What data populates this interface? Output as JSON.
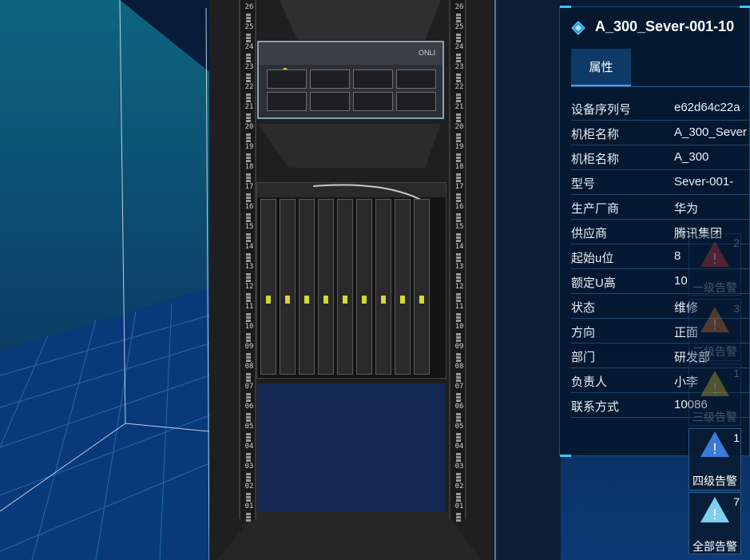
{
  "panel": {
    "title": "A_300_Sever-001-10",
    "tab_label": "属性",
    "properties": [
      {
        "key": "设备序列号",
        "value": "e62d64c22a"
      },
      {
        "key": "机柜名称",
        "value": "A_300_Sever"
      },
      {
        "key": "机柜名称",
        "value": "A_300"
      },
      {
        "key": "型号",
        "value": "Sever-001-"
      },
      {
        "key": "生产厂商",
        "value": "华为"
      },
      {
        "key": "供应商",
        "value": "腾讯集团"
      },
      {
        "key": "起始u位",
        "value": "8"
      },
      {
        "key": "额定U高",
        "value": "10"
      },
      {
        "key": "状态",
        "value": "维修"
      },
      {
        "key": "方向",
        "value": "正面"
      },
      {
        "key": "部门",
        "value": "研发部"
      },
      {
        "key": "负责人",
        "value": "小李"
      },
      {
        "key": "联系方式",
        "value": "10086"
      }
    ]
  },
  "alarms": [
    {
      "level_label": "一级告警",
      "count": "2",
      "color": "#e03a3a"
    },
    {
      "level_label": "二级告警",
      "count": "3",
      "color": "#e07a2a"
    },
    {
      "level_label": "三级告警",
      "count": "1",
      "color": "#d8c22a"
    },
    {
      "level_label": "四级告警",
      "count": "1",
      "color": "#3a7ad8"
    },
    {
      "level_label": "全部告警",
      "count": "7",
      "color": "#7fd0f0"
    }
  ],
  "rack": {
    "u_labels_left": [
      "26",
      "25",
      "24",
      "23",
      "22",
      "21",
      "20",
      "19",
      "18",
      "17",
      "16",
      "15",
      "14",
      "13",
      "12",
      "11",
      "10",
      "09",
      "08",
      "07",
      "06",
      "05",
      "04",
      "03",
      "02",
      "01"
    ],
    "u_labels_right": [
      "26",
      "25",
      "24",
      "23",
      "22",
      "21",
      "20",
      "19",
      "18",
      "17",
      "16",
      "15",
      "14",
      "13",
      "12",
      "11",
      "10",
      "09",
      "08",
      "07",
      "06",
      "05",
      "04",
      "03",
      "02",
      "01"
    ],
    "server_brand": "ONLI"
  },
  "colors": {
    "accent": "#38c8ff",
    "panel_bg": "#041830",
    "tab_active": "#0d3a66"
  }
}
